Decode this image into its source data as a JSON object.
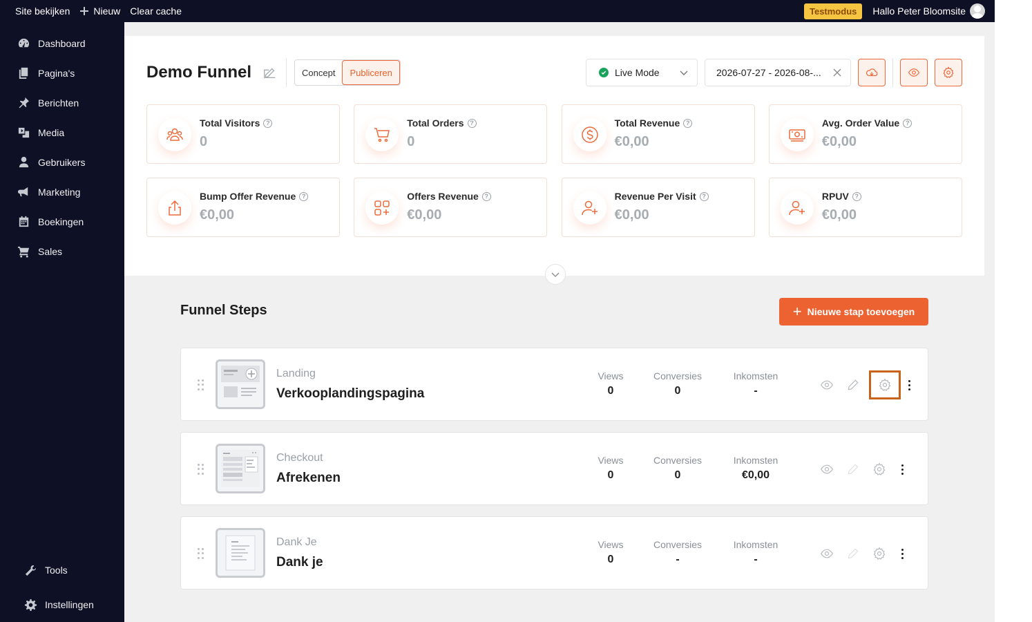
{
  "adminbar": {
    "site_label": "Site bekijken",
    "new_label": "Nieuw",
    "cache_label": "Clear cache",
    "testmode_badge": "Testmodus",
    "greeting": "Hallo Peter Bloomsite"
  },
  "sidebar": {
    "items": [
      {
        "label": "Dashboard",
        "icon": "dashboard-icon"
      },
      {
        "label": "Pagina's",
        "icon": "pages-icon"
      },
      {
        "label": "Berichten",
        "icon": "pin-icon"
      },
      {
        "label": "Media",
        "icon": "media-icon"
      },
      {
        "label": "Gebruikers",
        "icon": "user-icon"
      },
      {
        "label": "Marketing",
        "icon": "megaphone-icon"
      },
      {
        "label": "Boekingen",
        "icon": "calendar-icon"
      },
      {
        "label": "Sales",
        "icon": "cart-icon"
      }
    ],
    "bottom": [
      {
        "label": "Tools",
        "icon": "wrench-icon"
      },
      {
        "label": "Instellingen",
        "icon": "gear-icon"
      }
    ]
  },
  "funnel": {
    "title": "Demo Funnel",
    "status_options": [
      "Concept",
      "Publiceren"
    ],
    "status_selected": "Publiceren",
    "mode_label": "Live Mode",
    "date_range": "2026-07-27 - 2026-08-..."
  },
  "stats": [
    {
      "label": "Total Visitors",
      "value": "0",
      "icon": "users-icon"
    },
    {
      "label": "Total Orders",
      "value": "0",
      "icon": "cart-icon"
    },
    {
      "label": "Total Revenue",
      "value": "€0,00",
      "icon": "dollar-icon"
    },
    {
      "label": "Avg. Order Value",
      "value": "€0,00",
      "icon": "cash-icon"
    },
    {
      "label": "Bump Offer Revenue",
      "value": "€0,00",
      "icon": "share-icon"
    },
    {
      "label": "Offers Revenue",
      "value": "€0,00",
      "icon": "grid-plus-icon"
    },
    {
      "label": "Revenue Per Visit",
      "value": "€0,00",
      "icon": "user-plus-icon"
    },
    {
      "label": "RPUV",
      "value": "€0,00",
      "icon": "user-plus-icon"
    }
  ],
  "steps_section": {
    "title": "Funnel Steps",
    "add_button": "Nieuwe stap toevoegen"
  },
  "metric_labels": {
    "views": "Views",
    "conversions": "Conversies",
    "income": "Inkomsten"
  },
  "steps": [
    {
      "type": "Landing",
      "name": "Verkooplandingspagina",
      "views": "0",
      "conversions": "0",
      "income": "-"
    },
    {
      "type": "Checkout",
      "name": "Afrekenen",
      "views": "0",
      "conversions": "0",
      "income": "€0,00"
    },
    {
      "type": "Dank Je",
      "name": "Dank je",
      "views": "0",
      "conversions": "-",
      "income": "-"
    }
  ],
  "colors": {
    "accent": "#ec6231",
    "sidebar_bg": "#0e1026",
    "live_green": "#1aa35b",
    "highlight_border": "#c8631b"
  }
}
